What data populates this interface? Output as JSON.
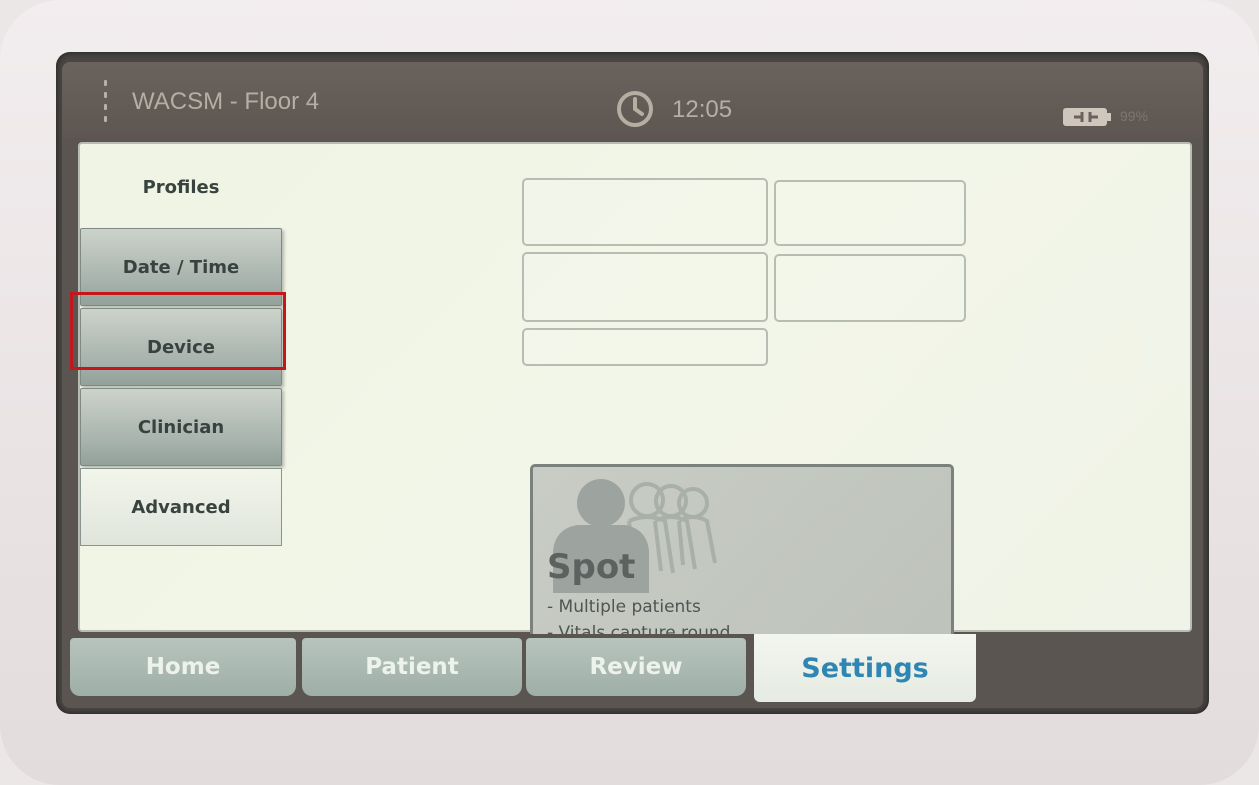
{
  "header": {
    "location": "WACSM - Floor 4",
    "time": "12:05",
    "battery_label": "99%"
  },
  "sidebar": {
    "items": [
      {
        "label": "Profiles"
      },
      {
        "label": "Date / Time"
      },
      {
        "label": "Device"
      },
      {
        "label": "Clinician"
      },
      {
        "label": "Advanced"
      }
    ]
  },
  "profile_card": {
    "title": "Spot",
    "lines": [
      "- Multiple patients",
      "- Vitals capture round"
    ]
  },
  "nav": {
    "tabs": [
      {
        "label": "Home"
      },
      {
        "label": "Patient"
      },
      {
        "label": "Review"
      },
      {
        "label": "Settings"
      }
    ]
  },
  "colors": {
    "highlight": "#c4171b",
    "selected_tab_text": "#2f86b3"
  }
}
